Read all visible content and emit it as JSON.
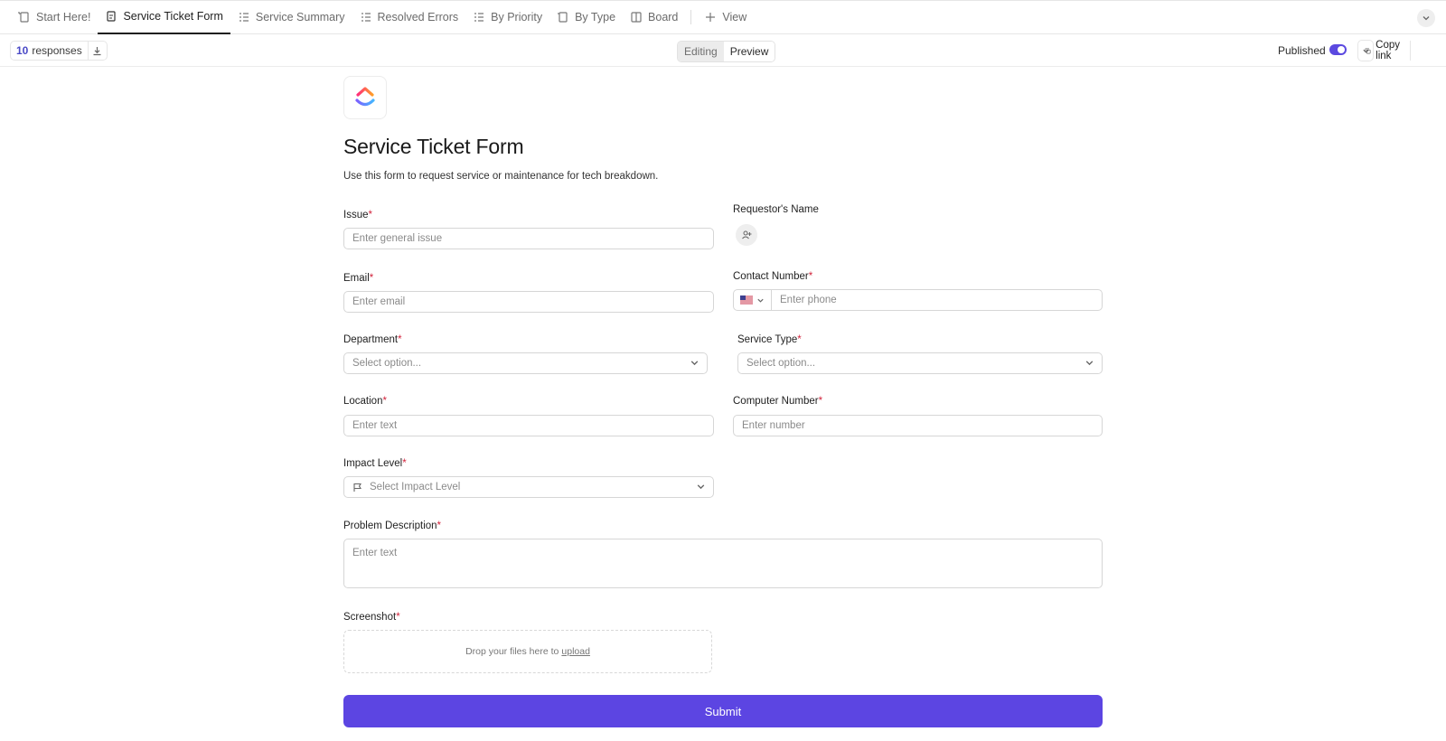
{
  "views": {
    "tabs": [
      {
        "label": "Start Here!",
        "icon": "doc-icon"
      },
      {
        "label": "Service Ticket Form",
        "icon": "form-icon",
        "active": true
      },
      {
        "label": "Service Summary",
        "icon": "list-icon"
      },
      {
        "label": "Resolved Errors",
        "icon": "list-icon"
      },
      {
        "label": "By Priority",
        "icon": "list-icon"
      },
      {
        "label": "By Type",
        "icon": "doc-icon"
      },
      {
        "label": "Board",
        "icon": "board-icon"
      }
    ],
    "add_view_label": "View"
  },
  "toolbar": {
    "responses_count": "10",
    "responses_label": "responses",
    "mode_editing": "Editing",
    "mode_preview": "Preview",
    "published_label": "Published",
    "published_on": true,
    "copy_link_label": "Copy link"
  },
  "form": {
    "title": "Service Ticket Form",
    "description": "Use this form to request service or maintenance for tech breakdown.",
    "fields": {
      "issue": {
        "label": "Issue",
        "placeholder": "Enter general issue"
      },
      "requestor": {
        "label": "Requestor's Name"
      },
      "email": {
        "label": "Email",
        "placeholder": "Enter email"
      },
      "contact": {
        "label": "Contact Number",
        "placeholder": "Enter phone",
        "flag": "US"
      },
      "department": {
        "label": "Department",
        "placeholder": "Select option..."
      },
      "service_type": {
        "label": "Service Type",
        "placeholder": "Select option..."
      },
      "location": {
        "label": "Location",
        "placeholder": "Enter text"
      },
      "computer_number": {
        "label": "Computer Number",
        "placeholder": "Enter number"
      },
      "impact_level": {
        "label": "Impact Level",
        "placeholder": "Select Impact Level"
      },
      "problem_description": {
        "label": "Problem Description",
        "placeholder": "Enter text"
      },
      "screenshot": {
        "label": "Screenshot",
        "drop_text": "Drop your files here to",
        "upload_link": "upload"
      }
    },
    "required_mark": "*",
    "submit_label": "Submit"
  },
  "colors": {
    "accent": "#5c45e2",
    "required": "#d2243c",
    "count": "#4a49c6"
  }
}
